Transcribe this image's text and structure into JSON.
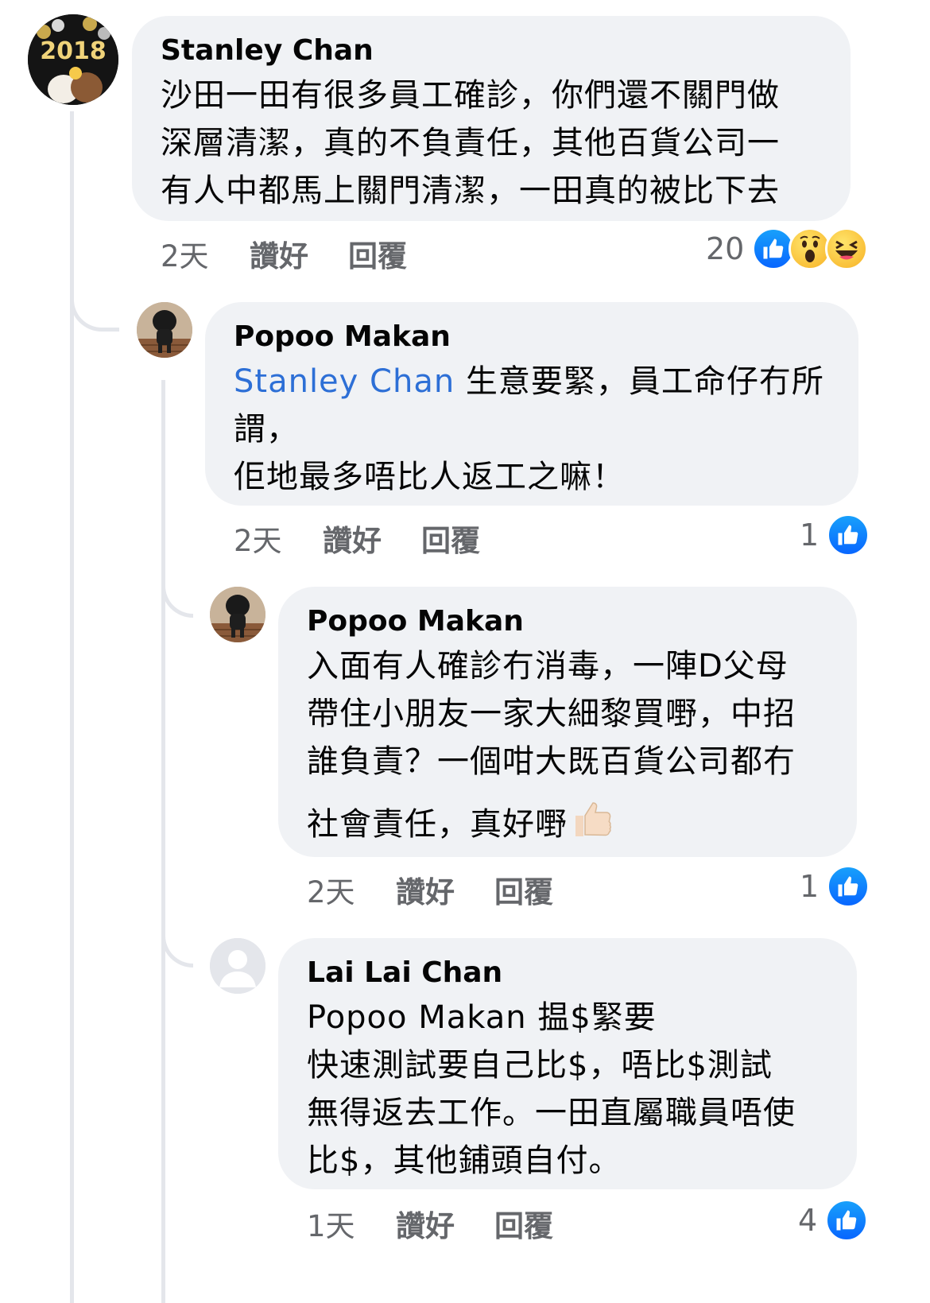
{
  "colors": {
    "bubble": "#f0f2f5",
    "mention": "#2d6fd6",
    "meta": "#65676b",
    "like_blue": "#0866ff"
  },
  "comments": [
    {
      "author": "Stanley Chan",
      "lines": [
        "沙田一田有很多員工確診，你們還不關門做",
        "深層清潔，真的不負責任，其他百貨公司一",
        "有人中都馬上關門清潔，一田真的被比下去"
      ],
      "time": "2天",
      "like_label": "讚好",
      "reply_label": "回覆",
      "reaction_count": "20",
      "reactions": [
        "like-icon",
        "wow-icon",
        "haha-icon"
      ]
    },
    {
      "author": "Popoo Makan",
      "mention": "Stanley Chan",
      "first_line_rest": " 生意要緊，員工命仔冇所",
      "lines": [
        "謂，",
        "佢地最多唔比人返工之嘛！"
      ],
      "time": "2天",
      "like_label": "讚好",
      "reply_label": "回覆",
      "reaction_count": "1",
      "reactions": [
        "like-icon"
      ]
    },
    {
      "author": "Popoo Makan",
      "lines": [
        "入面有人確診冇消毒，一陣D父母",
        "帶住小朋友一家大細黎買嘢，中招",
        "誰負責？一個咁大既百貨公司都冇",
        "社會責任，真好嘢"
      ],
      "emoji": "thumbs-up-emoji",
      "time": "2天",
      "like_label": "讚好",
      "reply_label": "回覆",
      "reaction_count": "1",
      "reactions": [
        "like-icon"
      ]
    },
    {
      "author": "Lai Lai Chan",
      "mention": "Popoo Makan",
      "first_line_rest": " 揾$緊要",
      "lines": [
        "快速測試要自己比$，唔比$測試",
        "無得返去工作。一田直屬職員唔使",
        "比$，其他鋪頭自付。"
      ],
      "time": "1天",
      "like_label": "讚好",
      "reply_label": "回覆",
      "reaction_count": "4",
      "reactions": [
        "like-icon"
      ]
    }
  ]
}
